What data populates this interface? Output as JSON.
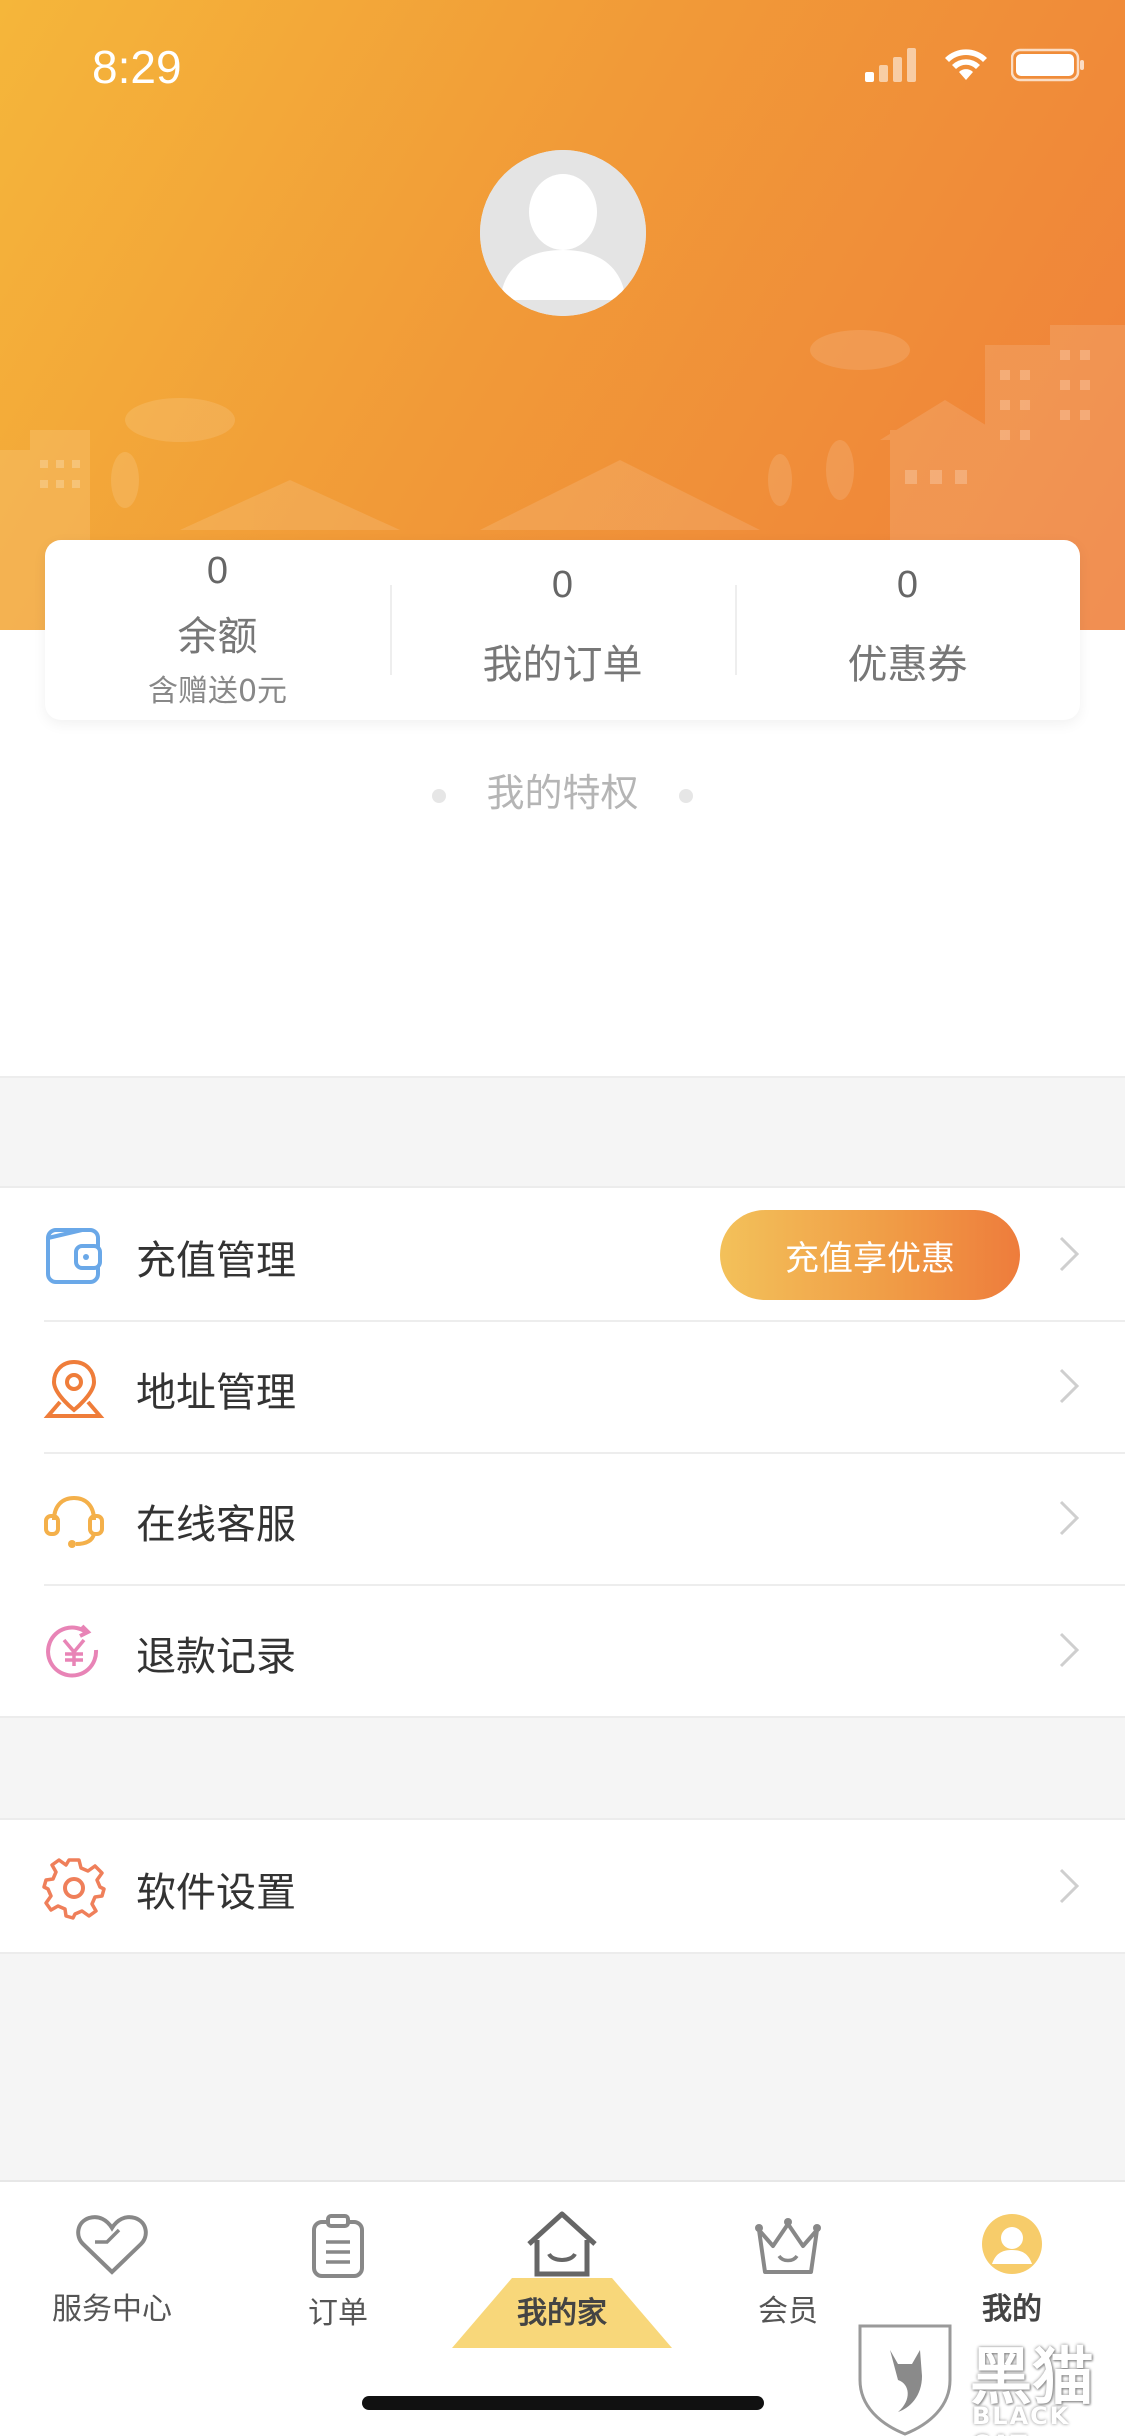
{
  "status_bar": {
    "time": "8:29"
  },
  "stats": {
    "balance": {
      "value": "0",
      "label": "余额",
      "sub": "含赠送0元"
    },
    "orders": {
      "value": "0",
      "label": "我的订单"
    },
    "coupons": {
      "value": "0",
      "label": "优惠券"
    }
  },
  "privilege": {
    "label": "我的特权"
  },
  "menu_group_1": {
    "items": [
      {
        "label": "充值管理",
        "icon": "wallet-icon",
        "badge": "充值享优惠"
      },
      {
        "label": "地址管理",
        "icon": "location-pin-icon"
      },
      {
        "label": "在线客服",
        "icon": "headset-icon"
      },
      {
        "label": "退款记录",
        "icon": "refund-yen-icon"
      }
    ]
  },
  "menu_group_2": {
    "items": [
      {
        "label": "软件设置",
        "icon": "gear-icon"
      }
    ]
  },
  "tab_bar": {
    "tabs": [
      {
        "label": "服务中心",
        "icon": "heart-icon"
      },
      {
        "label": "订单",
        "icon": "clipboard-icon"
      },
      {
        "label": "我的家",
        "icon": "house-icon"
      },
      {
        "label": "会员",
        "icon": "crown-icon"
      },
      {
        "label": "我的",
        "icon": "profile-icon"
      }
    ],
    "active": "我的"
  },
  "watermark": {
    "text": "黑猫",
    "sub": "BLACK CAT"
  },
  "colors": {
    "header_start": "#f5b63a",
    "header_end": "#ef7f3a",
    "accent": "#f09a45"
  }
}
